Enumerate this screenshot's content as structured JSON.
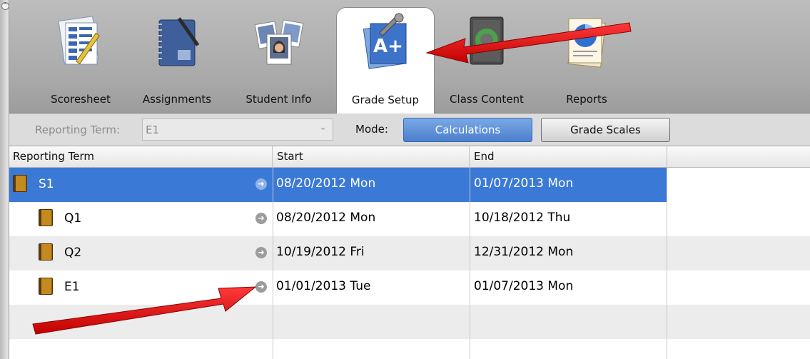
{
  "toolbar": {
    "tabs": [
      {
        "label": "Scoresheet",
        "icon": "scoresheet-icon",
        "active": false
      },
      {
        "label": "Assignments",
        "icon": "notebook-icon",
        "active": false
      },
      {
        "label": "Student Info",
        "icon": "student-photos-icon",
        "active": false
      },
      {
        "label": "Grade Setup",
        "icon": "grade-setup-icon",
        "active": true
      },
      {
        "label": "Class Content",
        "icon": "class-content-icon",
        "active": false
      },
      {
        "label": "Reports",
        "icon": "reports-icon",
        "active": false
      }
    ]
  },
  "filter": {
    "reporting_term_label": "Reporting Term:",
    "reporting_term_value": "E1",
    "mode_label": "Mode:",
    "mode_buttons": [
      "Calculations",
      "Grade Scales"
    ],
    "active_mode": "Calculations"
  },
  "grid": {
    "columns": [
      "Reporting Term",
      "Start",
      "End"
    ],
    "rows": [
      {
        "term": "S1",
        "start": "08/20/2012 Mon",
        "end": "01/07/2013 Mon",
        "level": 0,
        "selected": true
      },
      {
        "term": "Q1",
        "start": "08/20/2012 Mon",
        "end": "10/18/2012 Thu",
        "level": 1,
        "selected": false
      },
      {
        "term": "Q2",
        "start": "10/19/2012 Fri",
        "end": "12/31/2012 Mon",
        "level": 1,
        "selected": false
      },
      {
        "term": "E1",
        "start": "01/01/2013 Tue",
        "end": "01/07/2013 Mon",
        "level": 1,
        "selected": false
      }
    ]
  },
  "colors": {
    "selection": "#3b79d7",
    "annotation_arrow": "#e01010",
    "toolbar": "#a9a9a9"
  }
}
